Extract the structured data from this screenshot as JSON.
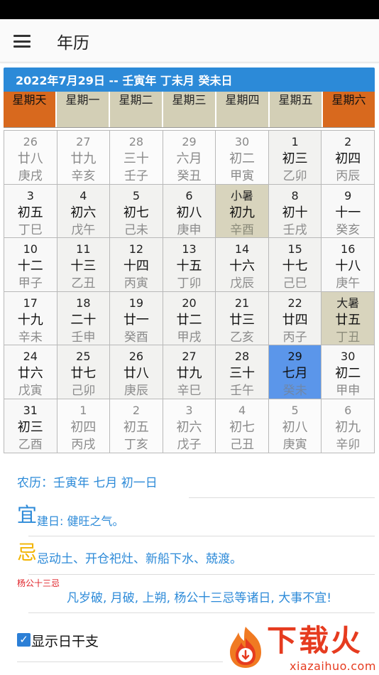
{
  "app": {
    "title": "年历"
  },
  "calendar": {
    "header": "2022年7月29日 -- 壬寅年 丁未月 癸未日",
    "weekdays": [
      "星期天",
      "星期一",
      "星期二",
      "星期三",
      "星期四",
      "星期五",
      "星期六"
    ],
    "rows": [
      [
        {
          "num": "26",
          "lunar": "廿八",
          "gz": "庚戌",
          "state": "other"
        },
        {
          "num": "27",
          "lunar": "廿九",
          "gz": "辛亥",
          "state": "other"
        },
        {
          "num": "28",
          "lunar": "三十",
          "gz": "壬子",
          "state": "other"
        },
        {
          "num": "29",
          "lunar": "六月",
          "gz": "癸丑",
          "state": "other"
        },
        {
          "num": "30",
          "lunar": "初二",
          "gz": "甲寅",
          "state": "other"
        },
        {
          "num": "1",
          "lunar": "初三",
          "gz": "乙卯",
          "state": "weekday"
        },
        {
          "num": "2",
          "lunar": "初四",
          "gz": "丙辰",
          "state": "weekend"
        }
      ],
      [
        {
          "num": "3",
          "lunar": "初五",
          "gz": "丁巳",
          "state": "weekend"
        },
        {
          "num": "4",
          "lunar": "初六",
          "gz": "戊午",
          "state": "weekday"
        },
        {
          "num": "5",
          "lunar": "初七",
          "gz": "己未",
          "state": "weekday"
        },
        {
          "num": "6",
          "lunar": "初八",
          "gz": "庚申",
          "state": "weekday"
        },
        {
          "num": "小暑",
          "lunar": "初九",
          "gz": "辛酉",
          "state": "term"
        },
        {
          "num": "8",
          "lunar": "初十",
          "gz": "壬戌",
          "state": "weekday"
        },
        {
          "num": "9",
          "lunar": "十一",
          "gz": "癸亥",
          "state": "weekend"
        }
      ],
      [
        {
          "num": "10",
          "lunar": "十二",
          "gz": "甲子",
          "state": "weekend"
        },
        {
          "num": "11",
          "lunar": "十三",
          "gz": "乙丑",
          "state": "weekday"
        },
        {
          "num": "12",
          "lunar": "十四",
          "gz": "丙寅",
          "state": "weekday"
        },
        {
          "num": "13",
          "lunar": "十五",
          "gz": "丁卯",
          "state": "weekday"
        },
        {
          "num": "14",
          "lunar": "十六",
          "gz": "戊辰",
          "state": "weekday"
        },
        {
          "num": "15",
          "lunar": "十七",
          "gz": "己巳",
          "state": "weekday"
        },
        {
          "num": "16",
          "lunar": "十八",
          "gz": "庚午",
          "state": "weekend"
        }
      ],
      [
        {
          "num": "17",
          "lunar": "十九",
          "gz": "辛未",
          "state": "weekend"
        },
        {
          "num": "18",
          "lunar": "二十",
          "gz": "壬申",
          "state": "weekday"
        },
        {
          "num": "19",
          "lunar": "廿一",
          "gz": "癸酉",
          "state": "weekday"
        },
        {
          "num": "20",
          "lunar": "廿二",
          "gz": "甲戌",
          "state": "weekday"
        },
        {
          "num": "21",
          "lunar": "廿三",
          "gz": "乙亥",
          "state": "weekday"
        },
        {
          "num": "22",
          "lunar": "廿四",
          "gz": "丙子",
          "state": "weekday"
        },
        {
          "num": "大暑",
          "lunar": "廿五",
          "gz": "丁丑",
          "state": "term"
        }
      ],
      [
        {
          "num": "24",
          "lunar": "廿六",
          "gz": "戊寅",
          "state": "weekend"
        },
        {
          "num": "25",
          "lunar": "廿七",
          "gz": "己卯",
          "state": "weekday"
        },
        {
          "num": "26",
          "lunar": "廿八",
          "gz": "庚辰",
          "state": "weekday"
        },
        {
          "num": "27",
          "lunar": "廿九",
          "gz": "辛巳",
          "state": "weekday"
        },
        {
          "num": "28",
          "lunar": "三十",
          "gz": "壬午",
          "state": "weekday"
        },
        {
          "num": "29",
          "lunar": "七月",
          "gz": "癸未",
          "state": "today"
        },
        {
          "num": "30",
          "lunar": "初二",
          "gz": "甲申",
          "state": "weekend"
        }
      ],
      [
        {
          "num": "31",
          "lunar": "初三",
          "gz": "乙酉",
          "state": "weekend"
        },
        {
          "num": "1",
          "lunar": "初四",
          "gz": "丙戌",
          "state": "other"
        },
        {
          "num": "2",
          "lunar": "初五",
          "gz": "丁亥",
          "state": "other"
        },
        {
          "num": "3",
          "lunar": "初六",
          "gz": "戊子",
          "state": "other"
        },
        {
          "num": "4",
          "lunar": "初七",
          "gz": "己丑",
          "state": "other"
        },
        {
          "num": "5",
          "lunar": "初八",
          "gz": "庚寅",
          "state": "other"
        },
        {
          "num": "6",
          "lunar": "初九",
          "gz": "辛卯",
          "state": "other"
        }
      ]
    ]
  },
  "info": {
    "lunar_date": "农历：壬寅年 七月 初一日",
    "yi_char": "宜",
    "yi_text": "建日: 健旺之气。",
    "ji_char": "忌",
    "ji_text": "忌动土、开仓祀灶、新船下水、兢渡。",
    "yang_label": "杨公十三忌",
    "yang_text": "凡岁破, 月破, 上朔, 杨公十三忌等诸日, 大事不宜!"
  },
  "settings": {
    "show_ganzhi_label": "显示日干支",
    "show_ganzhi_checked": true
  },
  "watermark": {
    "text": "下载火",
    "url": "xiazaihuo.com"
  },
  "colors": {
    "accent": "#2c8ad8",
    "weekend_header": "#d8691e",
    "weekday_header": "#d3cfb6",
    "today": "#5b96ea",
    "solar_term": "#d8d4bd",
    "ji": "#f2b400",
    "warn": "#e0242a"
  },
  "icons": {
    "menu": "hamburger-menu-icon",
    "checkbox": "check-icon"
  }
}
